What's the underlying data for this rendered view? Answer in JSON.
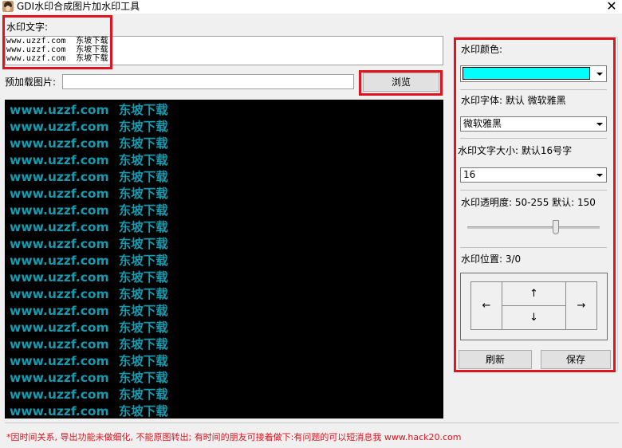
{
  "window": {
    "title": "GDI水印合成图片加水印工具",
    "close_glyph": "✕"
  },
  "watermark_text": {
    "label": "水印文字:",
    "lines": [
      "www.uzzf.com  东坡下载",
      "www.uzzf.com  东坡下载",
      "www.uzzf.com  东坡下载"
    ],
    "url": "www.uzzf.com",
    "cn": "东坡下载"
  },
  "preload": {
    "label": "预加载图片:",
    "value": "",
    "browse_label": "浏览"
  },
  "preview": {
    "background": "#000000",
    "text_color": "#159bb0",
    "url": "www.uzzf.com",
    "cn": "东坡下载",
    "row_count": 19
  },
  "settings": {
    "color_label": "水印颜色:",
    "color_value": "#00ffff",
    "font_label": "水印字体: 默认 微软雅黑",
    "font_value": "微软雅黑",
    "size_label": "水印文字大小: 默认16号字",
    "size_value": "16",
    "opacity_label": "水印透明度: 50-255 默认: 150",
    "opacity_value": 150,
    "opacity_range": [
      50,
      255
    ],
    "position_label": "水印位置: 3/0",
    "arrows": {
      "up": "↑",
      "down": "↓",
      "left": "←",
      "right": "→"
    },
    "refresh_label": "刷新",
    "save_label": "保存"
  },
  "status": {
    "text": "*因时间关系, 导出功能未做细化, 不能原图转出; 有时间的朋友可接着做下:有问题的可以短消息我 www.hack20.com",
    "color": "#e0141e"
  },
  "highlight_color": "#e0141e"
}
